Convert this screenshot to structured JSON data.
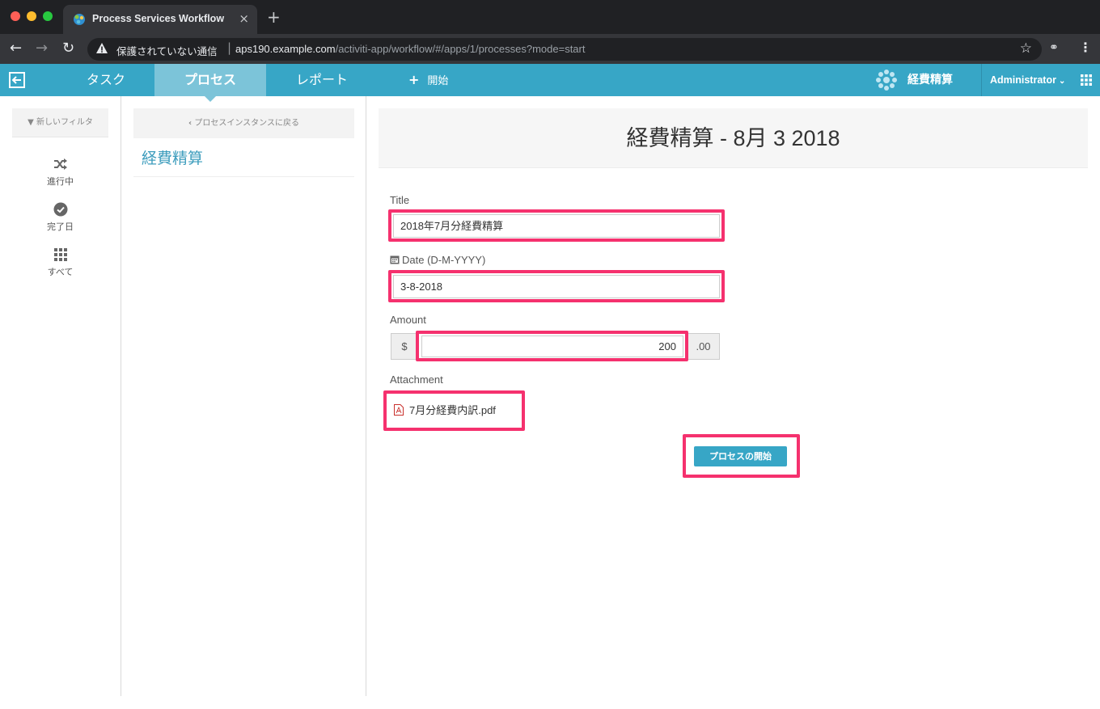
{
  "browser": {
    "tab_title": "Process Services Workflow",
    "tab_close": "×",
    "new_tab": "+",
    "security_text": "保護されていない通信",
    "url_host": "aps190.example.com",
    "url_path": "/activiti-app/workflow/#/apps/1/processes?mode=start"
  },
  "navbar": {
    "tabs": [
      {
        "label": "タスク",
        "active": false
      },
      {
        "label": "プロセス",
        "active": true
      },
      {
        "label": "レポート",
        "active": false
      }
    ],
    "start_label": "開始",
    "app_name": "経費精算",
    "user": "Administrator",
    "accent_color": "#37a6c6",
    "active_tab_color": "#7cc4d9"
  },
  "filters": {
    "new_filter_label": "新しいフィルタ",
    "items": [
      {
        "label": "進行中",
        "icon": "shuffle-icon"
      },
      {
        "label": "完了日",
        "icon": "check-circle-icon"
      },
      {
        "label": "すべて",
        "icon": "grid-icon"
      }
    ]
  },
  "middle": {
    "back_label": "プロセスインスタンスに戻る",
    "definition_label": "経費精算"
  },
  "form": {
    "heading": "経費精算 - 8月 3 2018",
    "title_label": "Title",
    "title_value": "2018年7月分経費精算",
    "date_label": "Date (D-M-YYYY)",
    "date_value": "3-8-2018",
    "amount_label": "Amount",
    "amount_prefix": "$",
    "amount_value": "200",
    "amount_suffix": ".00",
    "attachment_label": "Attachment",
    "attachment_file": "7月分経費内訳.pdf",
    "start_button": "プロセスの開始",
    "highlight_color": "#f5316e"
  }
}
